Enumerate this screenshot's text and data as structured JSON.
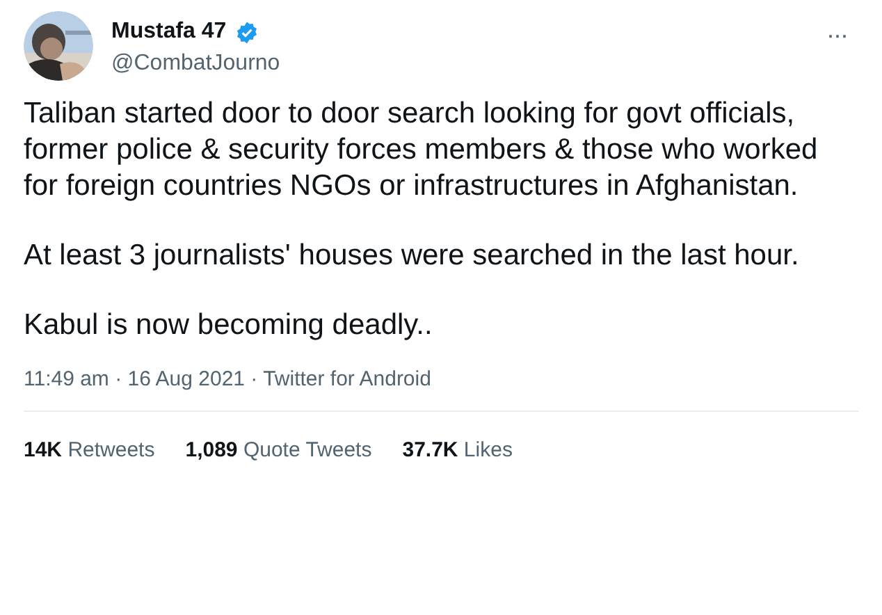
{
  "author": {
    "name": "Mustafa 47",
    "verified": true,
    "handle": "@CombatJourno"
  },
  "menu": "···",
  "paragraphs": [
    "Taliban started door to door search looking for govt officials, former police & security forces members & those who worked for foreign countries NGOs or infrastructures in Afghanistan.",
    "At least 3 journalists' houses were searched in the last hour.",
    "Kabul is now becoming deadly.."
  ],
  "meta": "11:49 am · 16 Aug 2021 · Twitter for Android",
  "stats": [
    "**14K** Retweets",
    "**1,089** Quote Tweets",
    "**37.7K** Likes"
  ]
}
